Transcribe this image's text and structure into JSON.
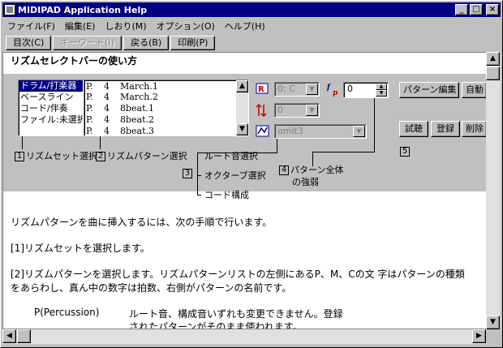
{
  "window": {
    "title": "MIDIPAD Application Help"
  },
  "title_buttons": {
    "minimize": "_",
    "maximize": "□",
    "close": "×"
  },
  "menu": [
    "ファイル(F)",
    "編集(E)",
    "しおり(M)",
    "オプション(O)",
    "ヘルプ(H)"
  ],
  "toolbar": [
    {
      "label": "目次(C)",
      "enabled": true
    },
    {
      "label": "キーワード(I)",
      "enabled": false
    },
    {
      "label": "戻る(B)",
      "enabled": true
    },
    {
      "label": "印刷(P)",
      "enabled": true
    }
  ],
  "heading": "リズムセレクトバーの使い方",
  "rhythm_set_list": [
    "ドラム/打楽器",
    "ベースライン",
    "コード/伴奏",
    "ファイル:未選択"
  ],
  "pattern_list": [
    {
      "page": "P.",
      "beat": "4",
      "name": "March.1"
    },
    {
      "page": "P.",
      "beat": "4",
      "name": "March.2"
    },
    {
      "page": "P.",
      "beat": "4",
      "name": "8beat.1"
    },
    {
      "page": "P.",
      "beat": "4",
      "name": "8beat.2"
    },
    {
      "page": "P.",
      "beat": "4",
      "name": "8beat.3"
    }
  ],
  "root_combo": "0: C",
  "octave_combo": "0",
  "chord_combo": "omit3",
  "velocity_spin": "0",
  "buttons": {
    "pattern_edit": "パターン編集",
    "auto": "自動",
    "preview": "試聴",
    "register": "登録",
    "delete": "削除"
  },
  "icons": {
    "root": "root-note-icon",
    "octave": "octave-icon",
    "chord": "chord-icon",
    "velocity": "velocity-icon"
  },
  "annotations": {
    "n1": "1",
    "a1": "リズムセット選択",
    "n2": "2",
    "a2": "リズムパターン選択",
    "n3": "3",
    "a3a": "ルート音選択",
    "a3b": "オクターブ選択",
    "a3c": "コード構成",
    "n4": "4",
    "a4a": "パターン全体",
    "a4b": "の強弱",
    "n5": "5"
  },
  "body": {
    "p1": "リズムパターンを曲に挿入するには、次の手順で行います。",
    "p2": "[1]リズムセットを選択します。",
    "p3a": "[2]リズムパターンを選択します。リズムパターンリストの左側にあるP、M、Cの文 字はパターンの種類",
    "p3b": "をあらわし、真ん中の数字は拍数、右側がパターンの名前です。",
    "term": "P(Percussion)",
    "def_a": "ルート音、構成音いずれも変更できません。登録",
    "def_b": "されたパターンがそのまま使われます。"
  }
}
